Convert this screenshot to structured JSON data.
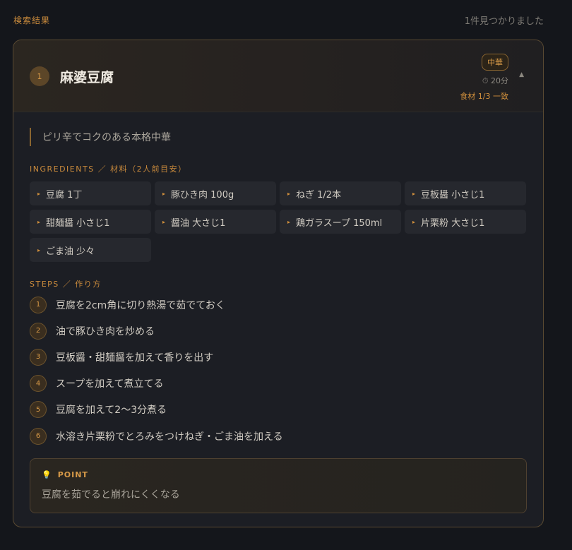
{
  "header": {
    "results_label": "検索結果",
    "results_count": "1件見つかりました"
  },
  "recipe": {
    "number": "1",
    "title": "麻婆豆腐",
    "cuisine": "中華",
    "time": "⏱ 20分",
    "match": "食材 1/3 一致",
    "collapse_icon": "▲",
    "description": "ピリ辛でコクのある本格中華",
    "ingredients_heading": "INGREDIENTS ／ 材料（2人前目安）",
    "ingredients": [
      "豆腐 1丁",
      "豚ひき肉 100g",
      "ねぎ 1/2本",
      "豆板醤 小さじ1",
      "甜麺醤 小さじ1",
      "醤油 大さじ1",
      "鶏ガラスープ 150ml",
      "片栗粉 大さじ1",
      "ごま油 少々"
    ],
    "steps_heading": "STEPS ／ 作り方",
    "steps": [
      {
        "num": "1",
        "text": "豆腐を2cm角に切り熱湯で茹でておく"
      },
      {
        "num": "2",
        "text": "油で豚ひき肉を炒める"
      },
      {
        "num": "3",
        "text": "豆板醤・甜麺醤を加えて香りを出す"
      },
      {
        "num": "4",
        "text": "スープを加えて煮立てる"
      },
      {
        "num": "5",
        "text": "豆腐を加えて2〜3分煮る"
      },
      {
        "num": "6",
        "text": "水溶き片栗粉でとろみをつけねぎ・ごま油を加える"
      }
    ],
    "point": {
      "icon": "💡",
      "label": "POINT",
      "text": "豆腐を茹でると崩れにくくなる"
    }
  },
  "colors": {
    "accent": "#d89a48",
    "background": "#14161b",
    "card": "#1c1e24"
  }
}
